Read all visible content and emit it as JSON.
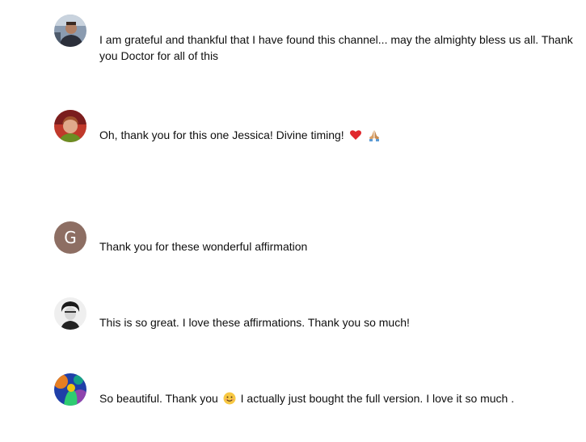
{
  "comments": [
    {
      "avatar": "user-photo-avatar",
      "text": "I am grateful and thankful that I have found this channel... may the almighty bless us all. Thank you Doctor for all of this"
    },
    {
      "avatar": "user-photo-avatar",
      "text": "Oh, thank you for this one Jessica! Divine timing!",
      "emojis": [
        "red-heart-emoji",
        "folded-hands-emoji"
      ]
    },
    {
      "avatar": "letter-avatar",
      "avatar_letter": "G",
      "avatar_color": "#8d6e63",
      "text": "Thank you for these wonderful affirmation"
    },
    {
      "avatar": "user-photo-avatar",
      "text": "This is so great. I love these affirmations. Thank you so much!"
    },
    {
      "avatar": "user-photo-avatar",
      "text_before": "So beautiful. Thank you",
      "emoji": "smiling-face-emoji",
      "text_after": "I actually just bought the full version. I love it so much ."
    }
  ]
}
